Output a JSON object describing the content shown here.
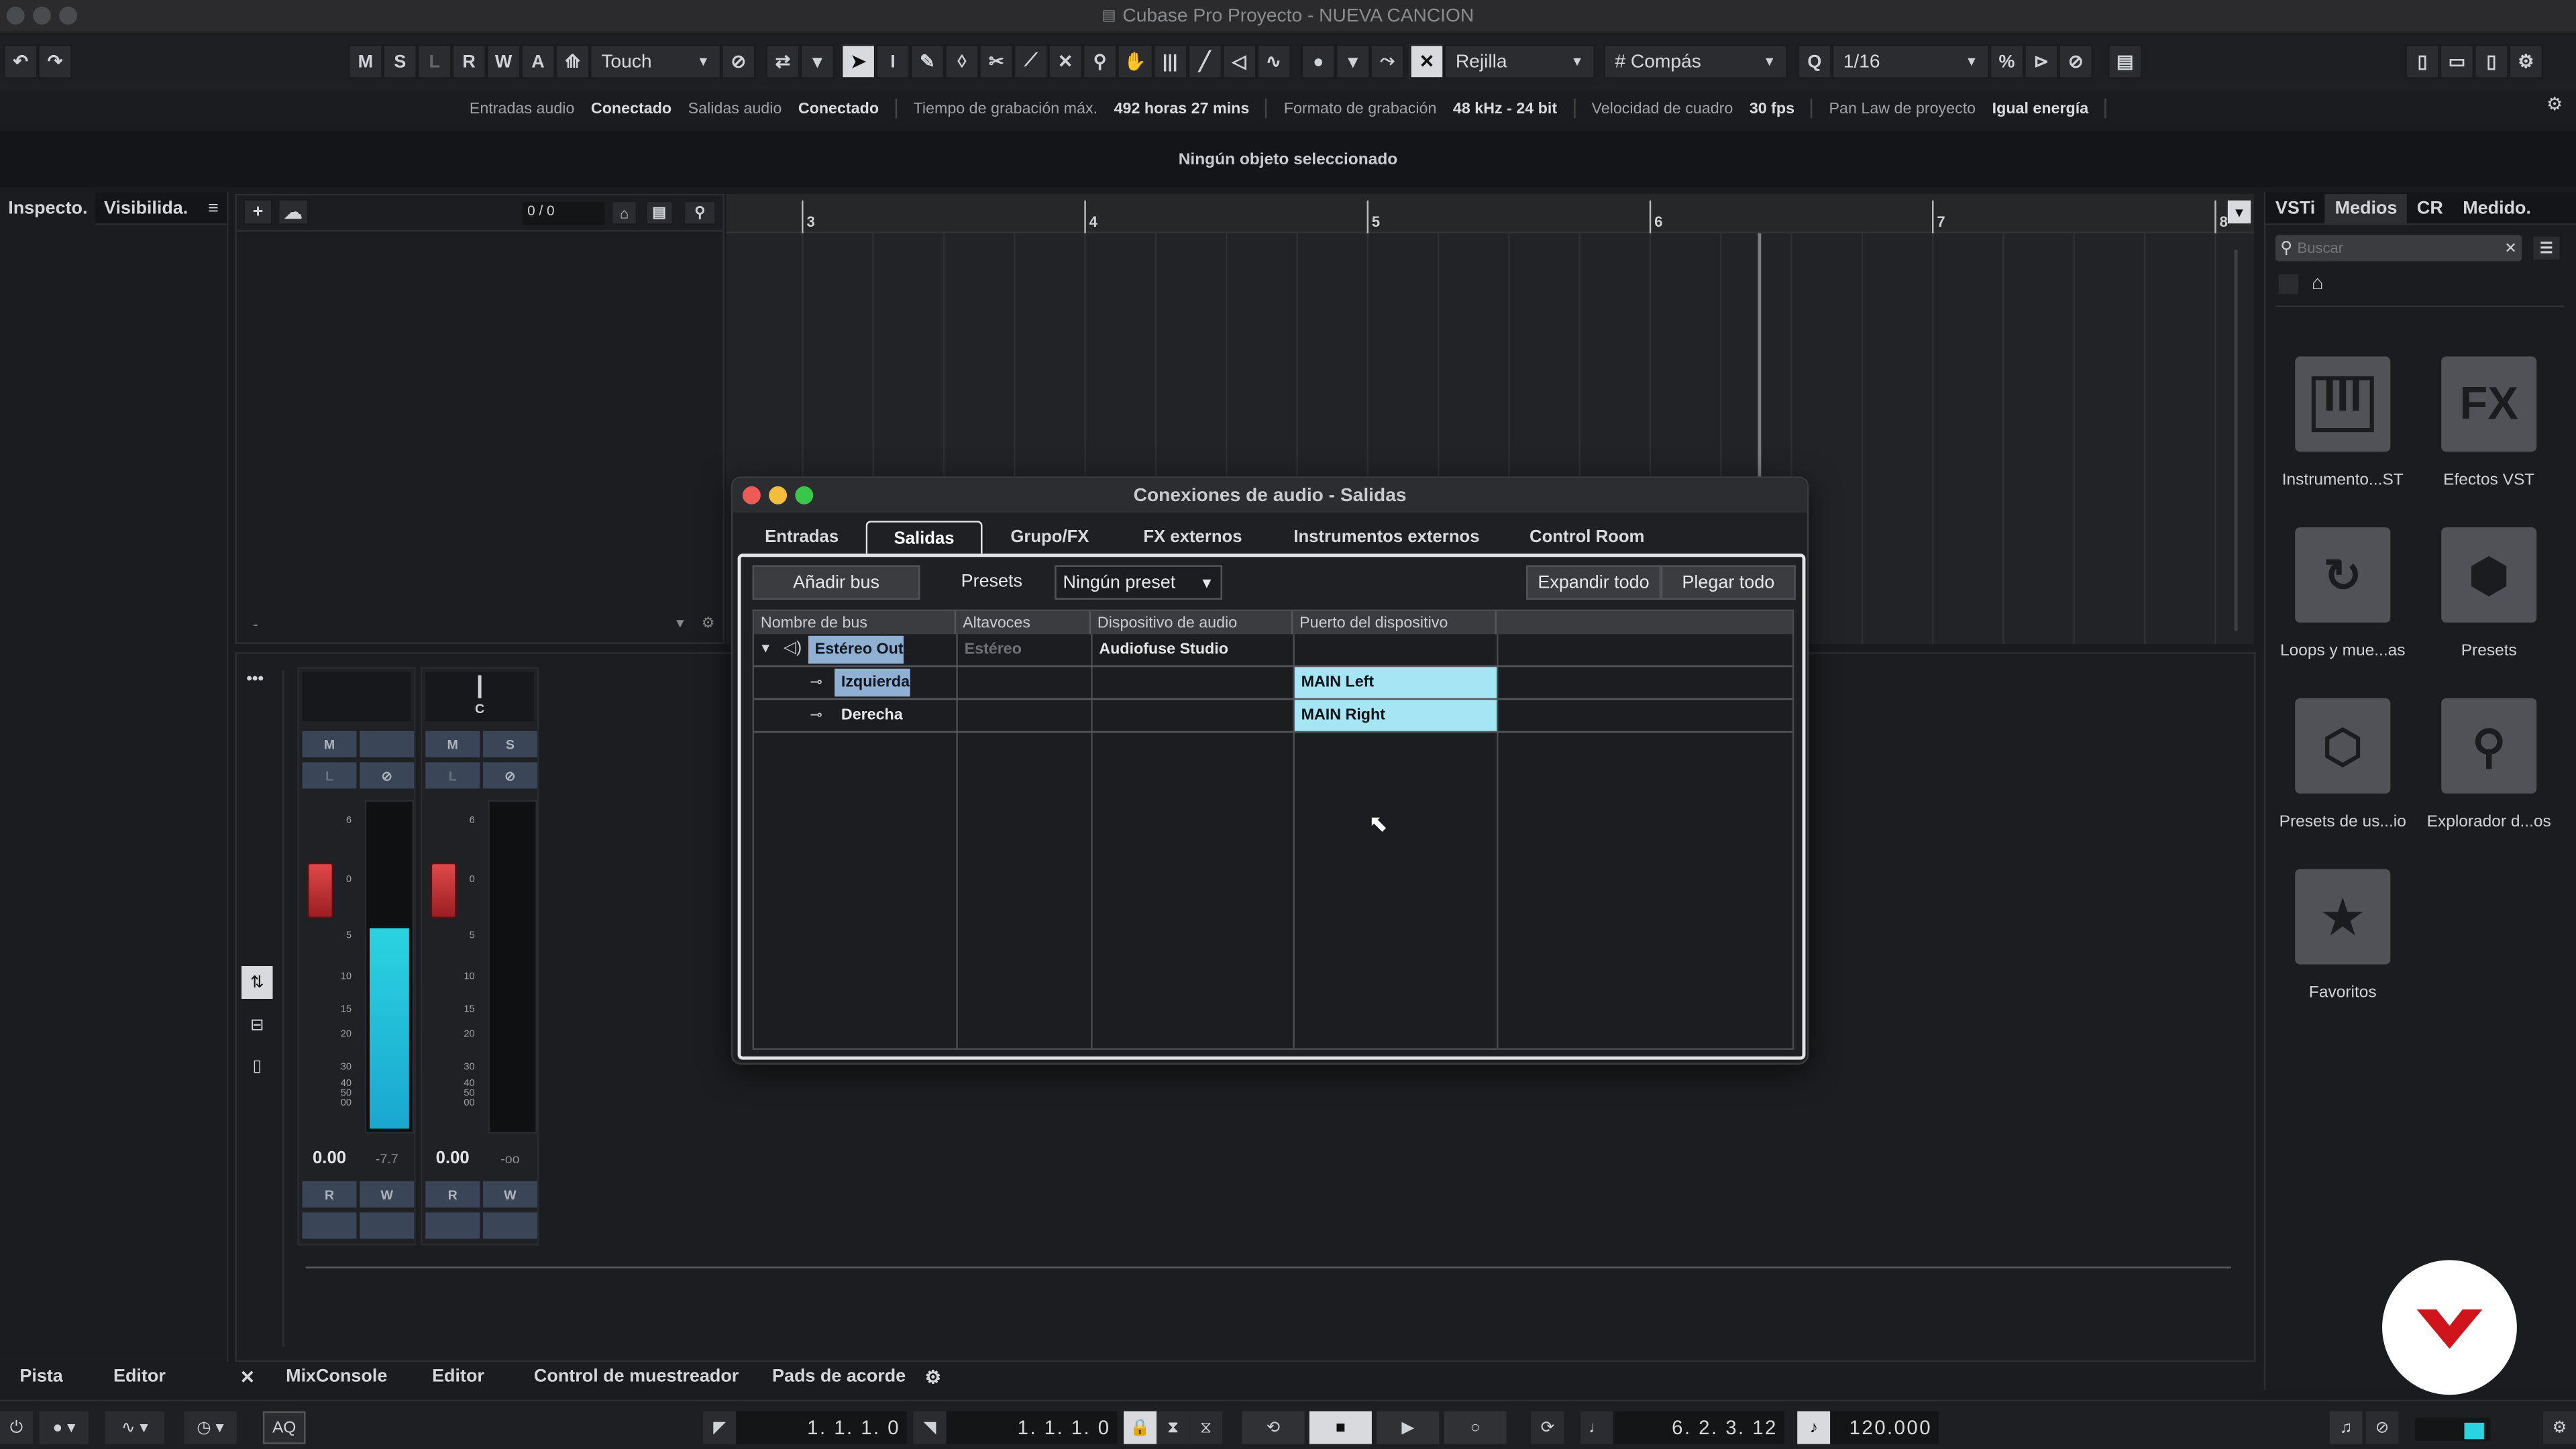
{
  "window": {
    "title": "Cubase Pro Proyecto - NUEVA CANCION"
  },
  "toolbar": {
    "mode_buttons": [
      "M",
      "S",
      "L",
      "R",
      "W",
      "A"
    ],
    "automation_mode": "Touch",
    "snap_type": "Rejilla",
    "grid_type": "Compás",
    "quantize": "1/16"
  },
  "status": {
    "audio_inputs_label": "Entradas audio",
    "audio_inputs_value": "Conectado",
    "audio_outputs_label": "Salidas audio",
    "audio_outputs_value": "Conectado",
    "max_rec_label": "Tiempo de grabación máx.",
    "max_rec_value": "492 horas 27 mins",
    "rec_format_label": "Formato de grabación",
    "rec_format_value": "48 kHz - 24 bit",
    "frame_rate_label": "Velocidad de cuadro",
    "frame_rate_value": "30 fps",
    "pan_law_label": "Pan Law de proyecto",
    "pan_law_value": "Igual energía"
  },
  "info_line": "Ningún objeto seleccionado",
  "left_tabs": {
    "inspector": "Inspecto.",
    "visibility": "Visibilida."
  },
  "tracklist": {
    "counter": "0 / 0"
  },
  "ruler": {
    "bars": [
      "3",
      "4",
      "5",
      "6",
      "7",
      "8"
    ]
  },
  "channels": [
    {
      "name": "",
      "pan": "",
      "mute": "M",
      "solo": "",
      "listen": "L",
      "volume": "0.00",
      "peak": "-7.7",
      "read": "R",
      "write": "W",
      "meter_level": 0.62
    },
    {
      "name": "",
      "pan": "C",
      "mute": "M",
      "solo": "S",
      "listen": "L",
      "volume": "0.00",
      "peak": "-oo",
      "read": "R",
      "write": "W",
      "meter_level": 0
    }
  ],
  "fader_scale": [
    "6",
    "0",
    "5",
    "10",
    "15",
    "20",
    "30",
    "40",
    "50",
    "00"
  ],
  "right_tabs": [
    "VSTi",
    "Medios",
    "CR",
    "Medido."
  ],
  "media": {
    "search_placeholder": "Buscar",
    "items": [
      {
        "label": "Instrumento...ST",
        "icon": "piano-icon"
      },
      {
        "label": "Efectos VST",
        "icon": "fx-icon"
      },
      {
        "label": "Loops y mue...as",
        "icon": "loop-icon"
      },
      {
        "label": "Presets",
        "icon": "presets-icon"
      },
      {
        "label": "Presets de us...io",
        "icon": "user-presets-icon"
      },
      {
        "label": "Explorador d...os",
        "icon": "explorer-icon"
      },
      {
        "label": "Favoritos",
        "icon": "star-icon"
      }
    ]
  },
  "bottom_tabs": {
    "track": "Pista",
    "editor_left": "Editor",
    "mixconsole": "MixConsole",
    "editor": "Editor",
    "sampler": "Control de muestreador",
    "chord_pads": "Pads de acorde"
  },
  "transport": {
    "aq": "AQ",
    "left_locator": "1. 1. 1.   0",
    "right_locator": "1. 1. 1.   0",
    "position": "6. 2. 3.  12",
    "tempo": "120.000"
  },
  "dialog": {
    "title": "Conexiones de audio - Salidas",
    "tabs": [
      "Entradas",
      "Salidas",
      "Grupo/FX",
      "FX externos",
      "Instrumentos externos",
      "Control Room"
    ],
    "add_bus": "Añadir bus",
    "presets_label": "Presets",
    "preset_value": "Ningún preset",
    "expand_all": "Expandir todo",
    "collapse_all": "Plegar todo",
    "columns": [
      "Nombre de bus",
      "Altavoces",
      "Dispositivo de audio",
      "Puerto del dispositivo"
    ],
    "rows": [
      {
        "name": "Estéreo Out",
        "speakers": "Estéreo",
        "device": "Audiofuse Studio",
        "port": ""
      },
      {
        "name": "Izquierda",
        "speakers": "",
        "device": "",
        "port": "MAIN Left"
      },
      {
        "name": "Derecha",
        "speakers": "",
        "device": "",
        "port": "MAIN Right"
      }
    ]
  },
  "colors": {
    "accent": "#a6e6f4",
    "meter": "#27c7d8",
    "fader": "#d83c3f",
    "logo": "#d0141b"
  }
}
